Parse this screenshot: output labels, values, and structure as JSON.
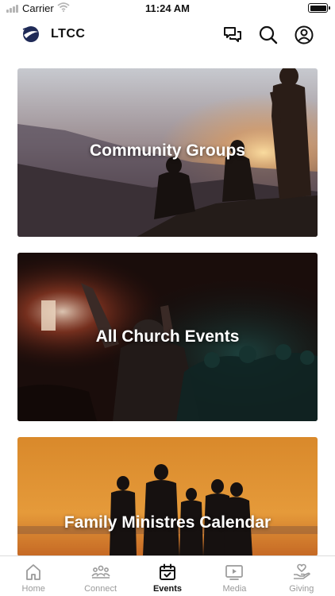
{
  "status_bar": {
    "carrier": "Carrier",
    "time": "11:24 AM"
  },
  "header": {
    "app_name": "LTCC",
    "icons": [
      "chat-icon",
      "search-icon",
      "profile-icon"
    ]
  },
  "feed": {
    "cards": [
      {
        "title": "Community Groups"
      },
      {
        "title": "All Church Events"
      },
      {
        "title": "Family Ministres Calendar"
      }
    ]
  },
  "tabbar": {
    "tabs": [
      {
        "label": "Home",
        "icon": "home-icon",
        "active": false
      },
      {
        "label": "Connect",
        "icon": "people-icon",
        "active": false
      },
      {
        "label": "Events",
        "icon": "calendar-icon",
        "active": true
      },
      {
        "label": "Media",
        "icon": "play-icon",
        "active": false
      },
      {
        "label": "Giving",
        "icon": "heart-hand-icon",
        "active": false
      }
    ]
  },
  "colors": {
    "active_tab": "#111111",
    "inactive_tab": "#9a9a9a",
    "logo_accent": "#1f2a57"
  }
}
